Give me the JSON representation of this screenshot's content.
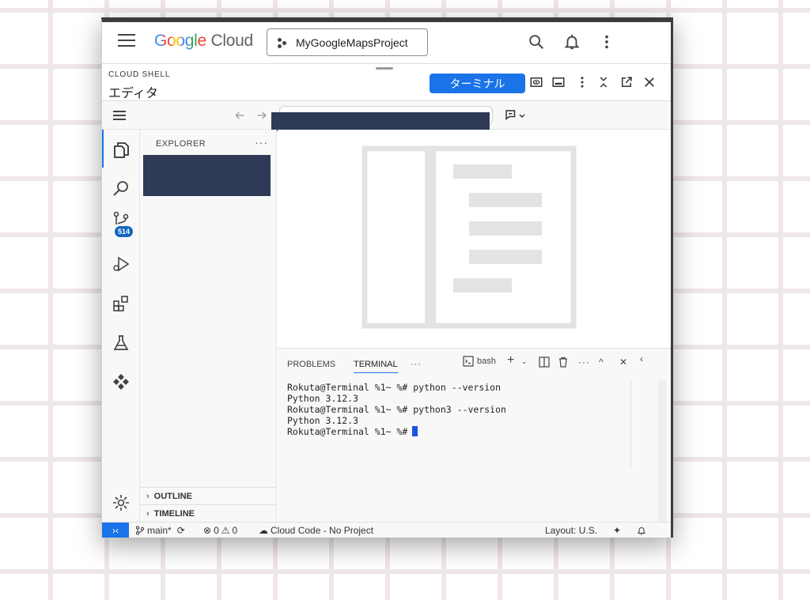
{
  "header": {
    "logo_google": "Google",
    "logo_cloud": "Cloud",
    "project_name": "MyGoogleMapsProject"
  },
  "shell": {
    "label": "CLOUD SHELL",
    "title": "エディタ",
    "terminal_button": "ターミナル"
  },
  "explorer": {
    "title": "EXPLORER",
    "more": "···",
    "sections": [
      "OUTLINE",
      "TIMELINE"
    ]
  },
  "activity": {
    "scm_badge": "514"
  },
  "panel": {
    "tabs": [
      "PROBLEMS",
      "TERMINAL"
    ],
    "active_tab": "TERMINAL",
    "shell_name": "bash",
    "lines": [
      "Rokuta@Terminal %1~ %# python --version",
      "Python 3.12.3",
      "Rokuta@Terminal %1~ %# python3 --version",
      "Python 3.12.3",
      "Rokuta@Terminal %1~ %#"
    ]
  },
  "status": {
    "branch": "main*",
    "errors": "0",
    "warnings": "0",
    "cloud_code": "Cloud Code - No Project",
    "layout": "Layout: U.S."
  },
  "colors": {
    "accent": "#1a73e8",
    "redaction": "#2e3a56"
  }
}
